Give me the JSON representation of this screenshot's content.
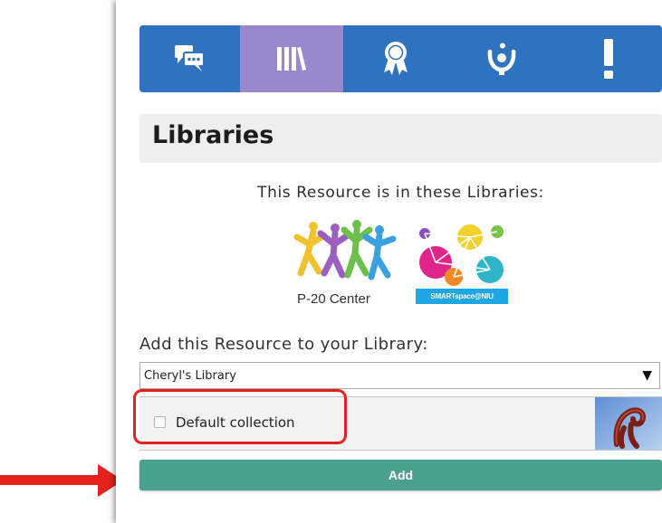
{
  "tabs": [
    {
      "name": "comments",
      "icon": "comments-icon",
      "color": "#2f72bf"
    },
    {
      "name": "libraries",
      "icon": "library-books-icon",
      "color": "#9988cc"
    },
    {
      "name": "standards",
      "icon": "award-ribbon-icon",
      "color": "#2f72bf"
    },
    {
      "name": "rate",
      "icon": "person-hand-icon",
      "color": "#2f72bf"
    },
    {
      "name": "report",
      "icon": "exclamation-icon",
      "color": "#2f72bf"
    }
  ],
  "section": {
    "heading": "Libraries",
    "in_libraries_text": "This Resource is in these Libraries:"
  },
  "libraries_listed": [
    {
      "caption": "P-20 Center",
      "logo_icon": "p20-center-logo"
    },
    {
      "caption": "SMARTspace@NIU",
      "logo_icon": "smartspace-logo"
    }
  ],
  "add_form": {
    "label": "Add this Resource to your Library:",
    "library_select_value": "Cheryl's Library",
    "select_arrow": "▼",
    "collection_label": "Default collection",
    "collection_checked": false,
    "add_button_label": "Add"
  },
  "annotations": {
    "highlight_color": "#e5211d",
    "arrow_color": "#e5211d"
  },
  "colors": {
    "tab_blue": "#2f72bf",
    "tab_active": "#9988cc",
    "add_button": "#4aa18d"
  }
}
